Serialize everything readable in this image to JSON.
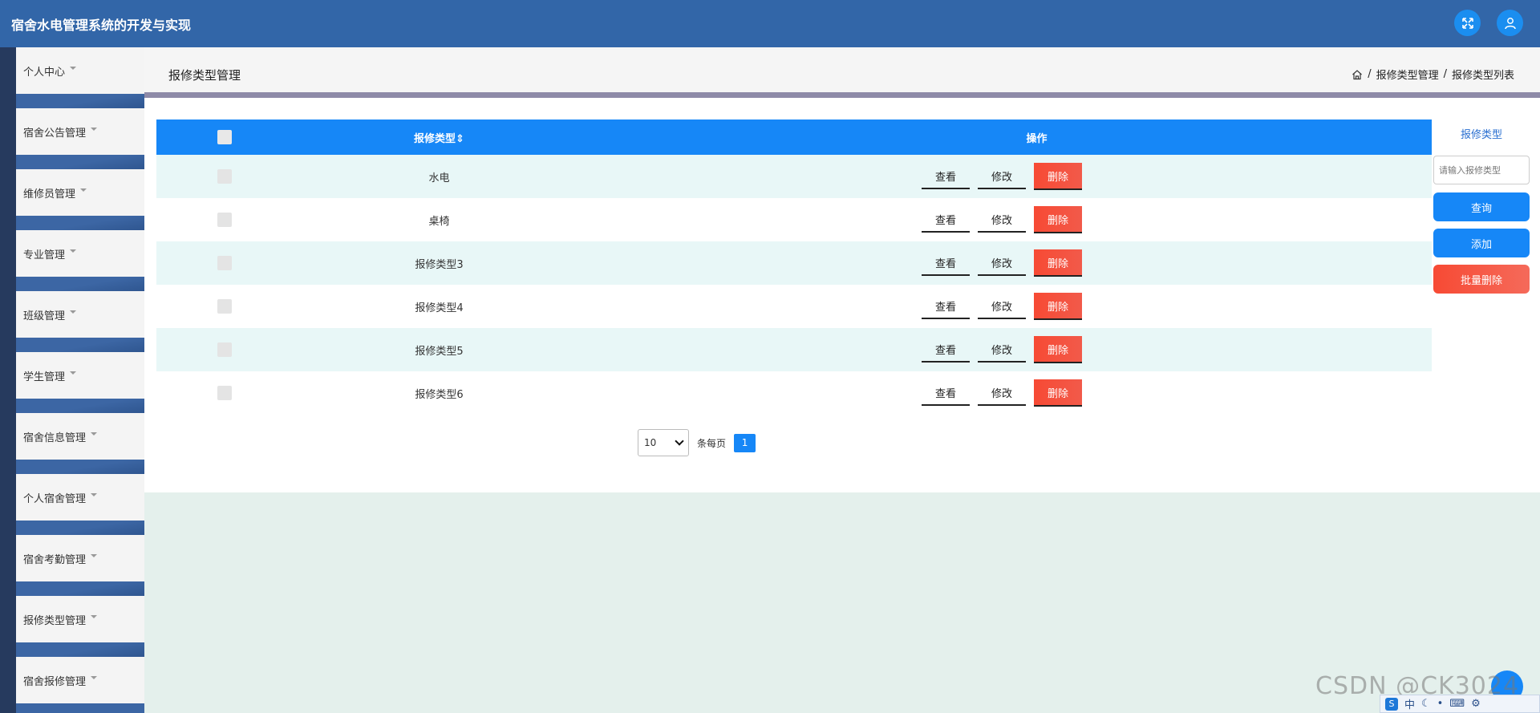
{
  "app": {
    "title": "宿舍水电管理系统的开发与实现"
  },
  "header": {
    "fullscreen_icon": "fullscreen-icon",
    "user_icon": "user-icon"
  },
  "sidebar": {
    "items": [
      {
        "label": "个人中心"
      },
      {
        "label": "宿舍公告管理"
      },
      {
        "label": "维修员管理"
      },
      {
        "label": "专业管理"
      },
      {
        "label": "班级管理"
      },
      {
        "label": "学生管理"
      },
      {
        "label": "宿舍信息管理"
      },
      {
        "label": "个人宿舍管理"
      },
      {
        "label": "宿舍考勤管理"
      },
      {
        "label": "报修类型管理"
      },
      {
        "label": "宿舍报修管理"
      }
    ]
  },
  "page": {
    "title": "报修类型管理",
    "breadcrumb": [
      "报修类型管理",
      "报修类型列表"
    ],
    "breadcrumb_sep": "/"
  },
  "table": {
    "columns": {
      "type": "报修类型",
      "sort_marker": "⇕",
      "ops": "操作"
    },
    "rows": [
      {
        "type": "水电"
      },
      {
        "type": "桌椅"
      },
      {
        "type": "报修类型3"
      },
      {
        "type": "报修类型4"
      },
      {
        "type": "报修类型5"
      },
      {
        "type": "报修类型6"
      }
    ],
    "actions": {
      "view": "查看",
      "edit": "修改",
      "delete": "删除"
    }
  },
  "pagination": {
    "page_size": "10",
    "per_page_label": "条每页",
    "current_page": "1"
  },
  "search": {
    "label": "报修类型",
    "placeholder": "请输入报修类型",
    "query_label": "查询",
    "add_label": "添加",
    "batch_delete_label": "批量删除"
  },
  "overlay": {
    "watermark": "CSDN @CK3024",
    "ime_text": "中"
  },
  "colors": {
    "header": "#3266a8",
    "primary": "#1687f7",
    "danger": "#f5503a"
  }
}
